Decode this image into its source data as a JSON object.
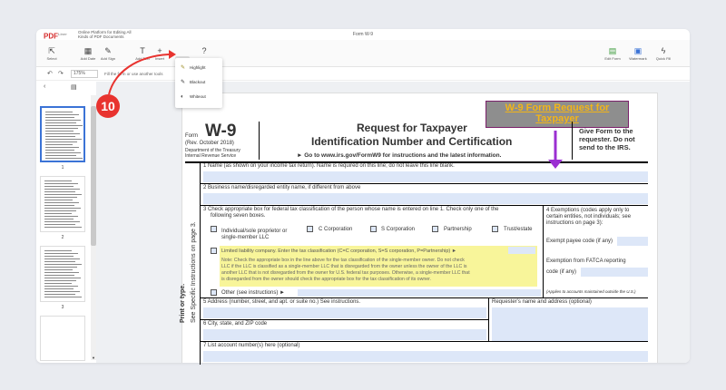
{
  "app": {
    "logo": "PDF",
    "logo_sub": "Liner",
    "tagline": "Online Platform for Editing All Kinds of PDF Documents",
    "window_title": "Form W-9"
  },
  "toolbar": {
    "select": "Select",
    "add_date": "Add Date",
    "add_sign": "Add Sign",
    "add_text": "Add Text",
    "insert": "Insert",
    "edit_form": "Edit Form",
    "watermark": "Watermark",
    "quick_fill": "Quick Fill"
  },
  "subbar": {
    "zoom": "175%",
    "hint": "Fill the form or use another tools"
  },
  "dropdown": {
    "items": [
      "Highlight",
      "Blackout",
      "Whiteout"
    ]
  },
  "annotation": {
    "step": "10",
    "stamp": "W-9 Form Request for Taxpayer",
    "colors": {
      "arrow": "#e8332f",
      "stamp_bg": "#8e8e8e",
      "stamp_text": "#f2b418",
      "purple": "#9b2fd2"
    }
  },
  "thumbs": {
    "pages": [
      "1",
      "2",
      "3"
    ]
  },
  "form": {
    "form_label": "Form",
    "form_no": "W-9",
    "rev": "(Rev. October 2018)",
    "dept": "Department of the Treasury",
    "irs": "Internal Revenue Service",
    "title1": "Request for Taxpayer",
    "title2": "Identification Number and Certification",
    "goto": "► Go to www.irs.gov/FormW9 for instructions and the latest information.",
    "give": "Give Form to the requester. Do not send to the IRS.",
    "line1": "1  Name (as shown on your income tax return). Name is required on this line; do not leave this line blank.",
    "line2": "2  Business name/disregarded entity name, if different from above",
    "line3a": "3  Check appropriate box for federal tax classification of the person whose name is entered on line 1. Check only one of the",
    "line3b": "following seven boxes.",
    "opt_individual": "Individual/sole proprietor or",
    "opt_individual2": "single-member LLC",
    "opt_ccorp": "C Corporation",
    "opt_scorp": "S Corporation",
    "opt_partnership": "Partnership",
    "opt_trust": "Trust/estate",
    "llc": "Limited liability company. Enter the tax classification (C=C corporation, S=S corporation, P=Partnership) ►",
    "note1": "Note: Check the appropriate box in the line above for the tax classification of the single-member owner.  Do not check",
    "note2": "LLC if the LLC is classified as a single-member LLC that is disregarded from the owner unless the owner of the LLC is",
    "note3": "another LLC that is not disregarded from the owner for U.S. federal tax purposes. Otherwise, a single-member LLC that",
    "note4": "is disregarded from the owner should check the appropriate box for the tax classification of its owner.",
    "other": "Other (see instructions) ►",
    "ex1": "4  Exemptions (codes apply only to",
    "ex2": "certain entities, not individuals; see",
    "ex3": "instructions on page 3):",
    "exempt_payee": "Exempt payee code (if any)",
    "fatca1": "Exemption from FATCA reporting",
    "fatca2": "code (if any)",
    "applies": "(Applies to accounts maintained outside the U.S.)",
    "line5": "5  Address (number, street, and apt. or suite no.) See instructions.",
    "requester": "Requester's name and address (optional)",
    "line6": "6  City, state, and ZIP code",
    "line7": "7  List account number(s) here (optional)",
    "side1": "Print or type.",
    "side2": "See Specific Instructions on page 3."
  }
}
